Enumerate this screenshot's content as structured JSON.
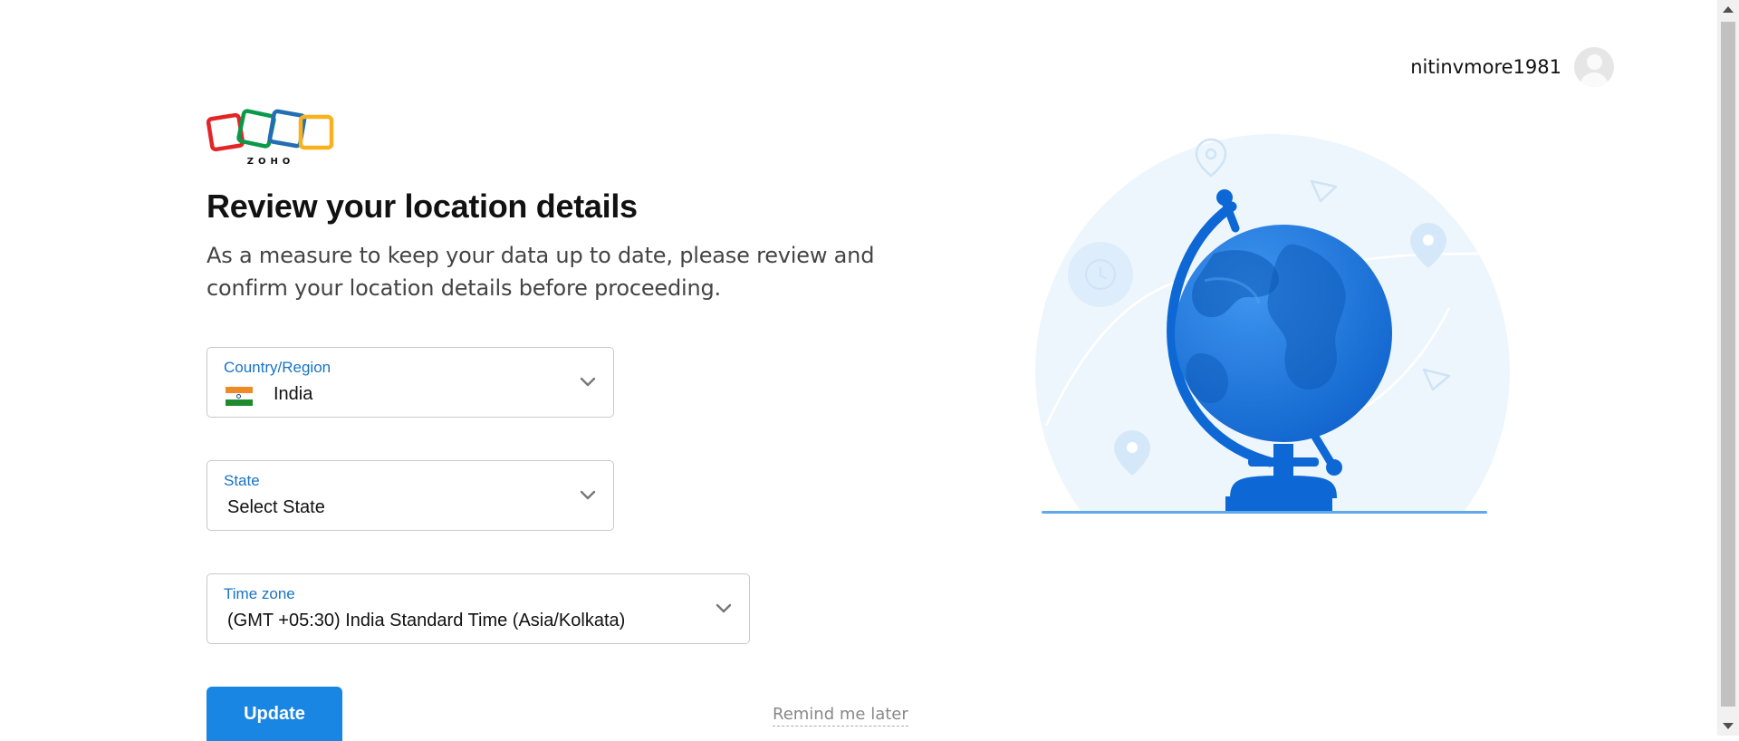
{
  "header": {
    "username": "nitinvmore1981"
  },
  "brand": {
    "logo_text": "ZOHO",
    "colors": [
      "#e42527",
      "#089949",
      "#226db4",
      "#f9b21d"
    ]
  },
  "page": {
    "title": "Review your location details",
    "subtitle": "As a measure to keep your data up to date, please review and confirm your location details before proceeding."
  },
  "form": {
    "country": {
      "label": "Country/Region",
      "value": "India",
      "flag": "india-flag"
    },
    "state": {
      "label": "State",
      "value": "Select State"
    },
    "timezone": {
      "label": "Time zone",
      "value": "(GMT +05:30) India Standard Time (Asia/Kolkata)"
    }
  },
  "actions": {
    "update_label": "Update",
    "remind_label": "Remind me later"
  },
  "theme": {
    "accent": "#1a86e3",
    "label_color": "#1a73c7"
  }
}
